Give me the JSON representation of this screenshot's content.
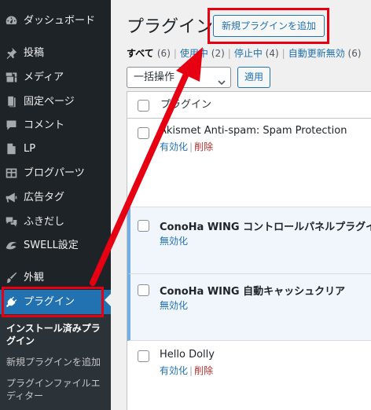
{
  "sidebar": {
    "items": [
      {
        "label": "ダッシュボード",
        "icon": "dashboard-icon"
      },
      {
        "label": "投稿",
        "icon": "pin-icon"
      },
      {
        "label": "メディア",
        "icon": "media-icon"
      },
      {
        "label": "固定ページ",
        "icon": "page-icon"
      },
      {
        "label": "コメント",
        "icon": "comment-icon"
      },
      {
        "label": "LP",
        "icon": "document-icon"
      },
      {
        "label": "ブログパーツ",
        "icon": "table-icon"
      },
      {
        "label": "広告タグ",
        "icon": "megaphone-icon"
      },
      {
        "label": "ふきだし",
        "icon": "speech-bubble-icon"
      },
      {
        "label": "SWELL設定",
        "icon": "swell-icon"
      },
      {
        "label": "外観",
        "icon": "brush-icon"
      },
      {
        "label": "プラグイン",
        "icon": "plugin-icon"
      }
    ],
    "submenu": [
      {
        "label": "インストール済みプラグイン"
      },
      {
        "label": "新規プラグインを追加"
      },
      {
        "label": "プラグインファイルエディター"
      }
    ]
  },
  "header": {
    "title": "プラグイン",
    "add_new_label": "新規プラグインを追加"
  },
  "filters": [
    {
      "label": "すべて",
      "count": "(6)"
    },
    {
      "label": "使用中",
      "count": "(2)"
    },
    {
      "label": "停止中",
      "count": "(4)"
    },
    {
      "label": "自動更新無効",
      "count": "(6)"
    }
  ],
  "bulk_actions": {
    "selected": "一括操作",
    "apply_label": "適用"
  },
  "table": {
    "column_header": "プラグイン",
    "rows": [
      {
        "name": "Akismet Anti-spam: Spam Protection",
        "action1": "有効化",
        "separator": "|",
        "action2": "削除"
      },
      {
        "name": "ConoHa WING コントロールパネルプラグイン",
        "action1": "無効化"
      },
      {
        "name": "ConoHa WING 自動キャッシュクリア",
        "action1": "無効化"
      },
      {
        "name": "Hello Dolly",
        "action1": "有効化",
        "separator": "|",
        "action2": "削除"
      }
    ]
  },
  "colors": {
    "sidebar_bg": "#1d2327",
    "accent": "#2271b1",
    "annotation": "#e60012"
  }
}
